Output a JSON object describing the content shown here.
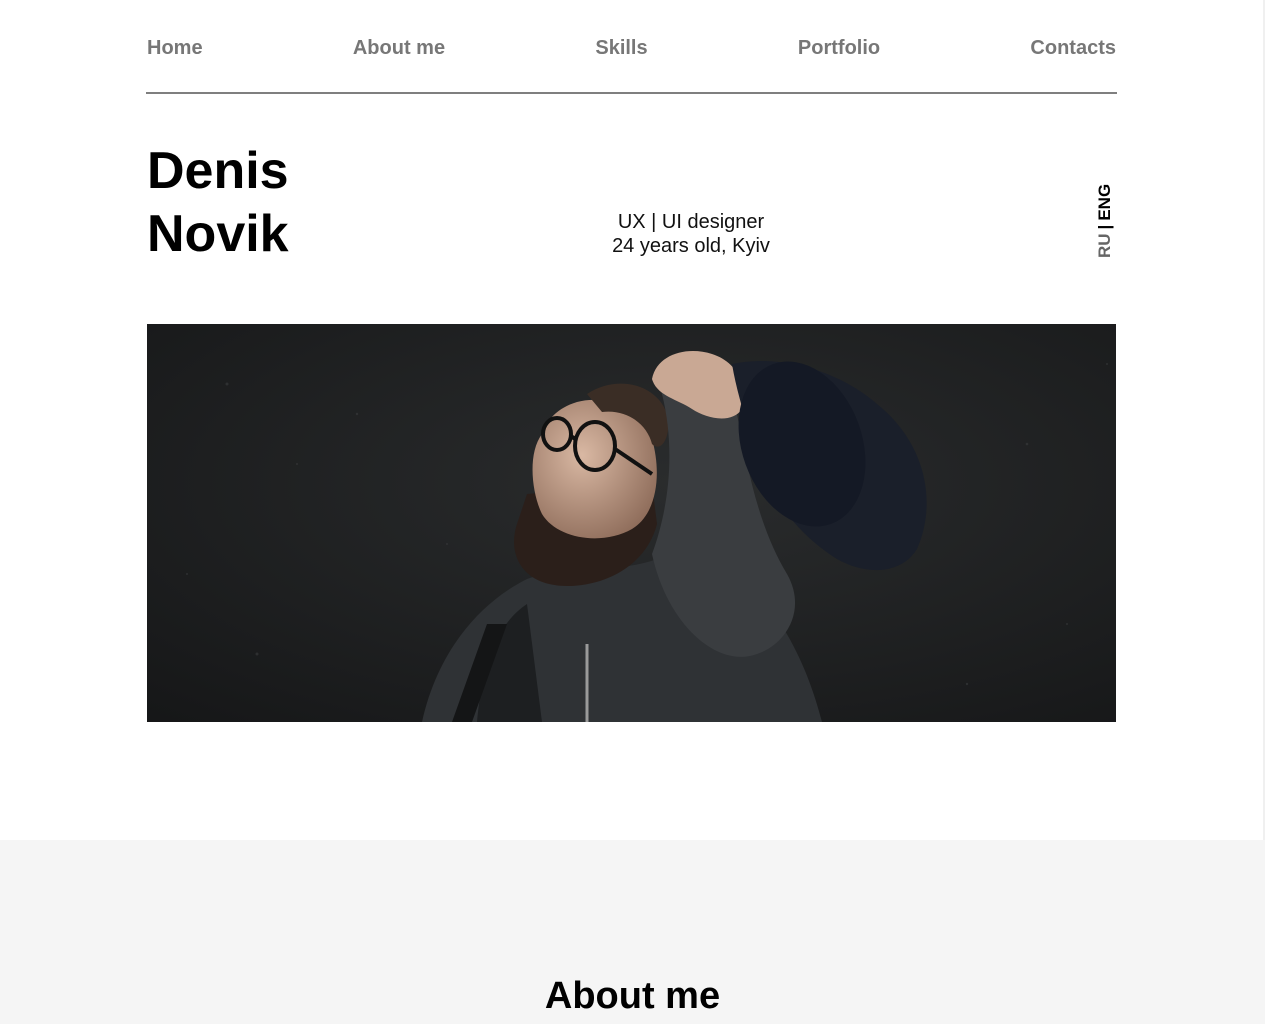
{
  "nav": {
    "items": [
      {
        "label": "Home"
      },
      {
        "label": "About me"
      },
      {
        "label": "Skills"
      },
      {
        "label": "Portfolio"
      },
      {
        "label": "Contacts"
      }
    ]
  },
  "hero": {
    "first_name": "Denis",
    "last_name": "Novik",
    "role": "UX | UI designer",
    "details": "24 years old, Kyiv",
    "lang": {
      "ru": "RU",
      "separator": "|",
      "en": "ENG",
      "active": "ENG"
    },
    "photo_alt": "portrait-photo"
  },
  "about": {
    "title": "About me"
  },
  "colors": {
    "nav_text": "#777777",
    "divider": "#7f7f7f",
    "section_bg": "#f5f5f5",
    "photo_bg": "#1d1f20"
  }
}
